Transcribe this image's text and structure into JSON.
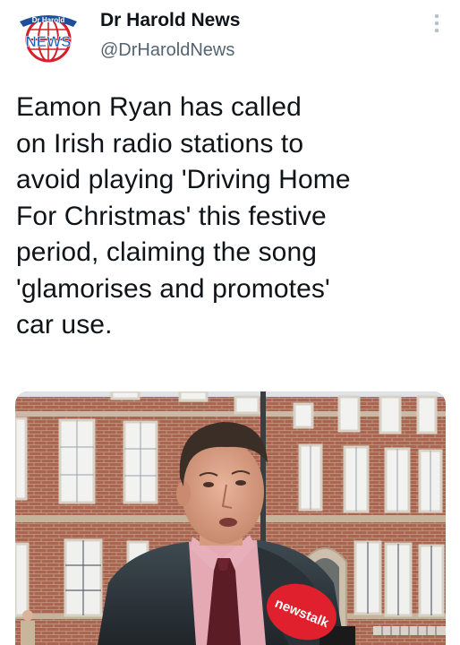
{
  "author": {
    "display_name": "Dr Harold News",
    "handle": "@DrHaroldNews",
    "avatar_icon": "dr-harold-news-logo",
    "avatar_text_top": "Dr Harold",
    "avatar_text_main": "NEWS"
  },
  "menu": {
    "icon": "more-vertical-icon"
  },
  "tweet": {
    "text": "Eamon Ryan has called\non Irish radio stations to\navoid playing 'Driving Home\nFor Christmas' this festive\nperiod, claiming the song\n'glamorises and promotes'\ncar use."
  },
  "media": {
    "microphone_label": "newstalk"
  },
  "colors": {
    "text_primary": "#0f1419",
    "text_secondary": "#536471",
    "logo_red": "#d3202a",
    "logo_blue": "#1d63b4",
    "brick": "#a86550",
    "mic_red": "#e0202c"
  }
}
